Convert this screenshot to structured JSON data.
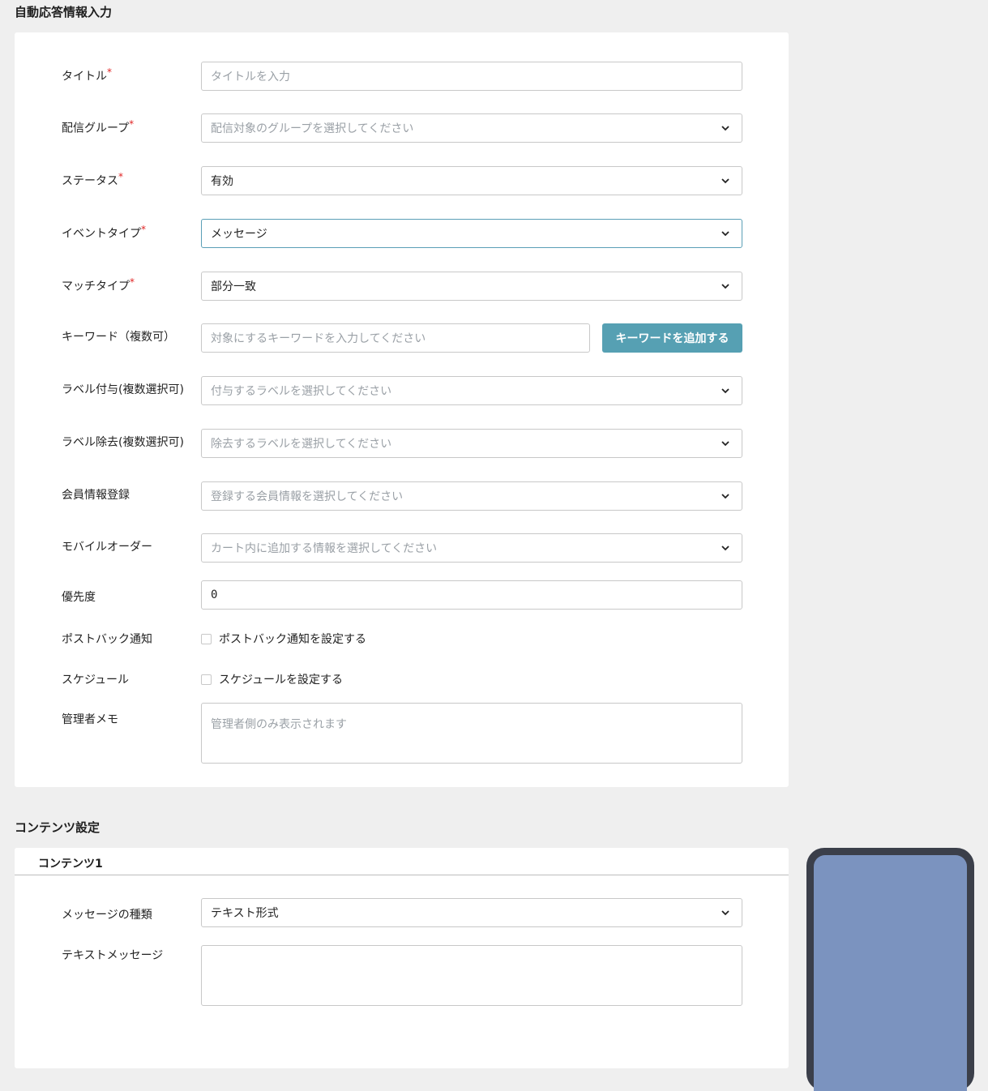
{
  "form_section": {
    "title": "自動応答情報入力",
    "required_mark": "*",
    "fields": {
      "title": {
        "label": "タイトル",
        "placeholder": "タイトルを入力"
      },
      "group": {
        "label": "配信グループ",
        "placeholder": "配信対象のグループを選択してください"
      },
      "status": {
        "label": "ステータス",
        "value": "有効"
      },
      "event_type": {
        "label": "イベントタイプ",
        "value": "メッセージ"
      },
      "match_type": {
        "label": "マッチタイプ",
        "value": "部分一致"
      },
      "keyword": {
        "label": "キーワード（複数可）",
        "placeholder": "対象にするキーワードを入力してください",
        "button": "キーワードを追加する"
      },
      "label_add": {
        "label": "ラベル付与(複数選択可)",
        "placeholder": "付与するラベルを選択してください"
      },
      "label_remove": {
        "label": "ラベル除去(複数選択可)",
        "placeholder": "除去するラベルを選択してください"
      },
      "member_info": {
        "label": "会員情報登録",
        "placeholder": "登録する会員情報を選択してください"
      },
      "mobile_order": {
        "label": "モバイルオーダー",
        "placeholder": "カート内に追加する情報を選択してください"
      },
      "priority": {
        "label": "優先度",
        "value": "0"
      },
      "postback": {
        "label": "ポストバック通知",
        "checkbox_text": "ポストバック通知を設定する"
      },
      "schedule": {
        "label": "スケジュール",
        "checkbox_text": "スケジュールを設定する"
      },
      "memo": {
        "label": "管理者メモ",
        "placeholder": "管理者側のみ表示されます"
      }
    }
  },
  "content_section": {
    "title": "コンテンツ設定",
    "card_title": "コンテンツ1",
    "message_type": {
      "label": "メッセージの種類",
      "value": "テキスト形式"
    },
    "text_message": {
      "label": "テキストメッセージ",
      "value": ""
    }
  },
  "colors": {
    "accent": "#56a0b3",
    "required": "#e02424",
    "phone_frame": "#3b3f4a",
    "phone_screen": "#7b93bf"
  },
  "icons": {
    "dropdown": "chevron-down-icon"
  }
}
